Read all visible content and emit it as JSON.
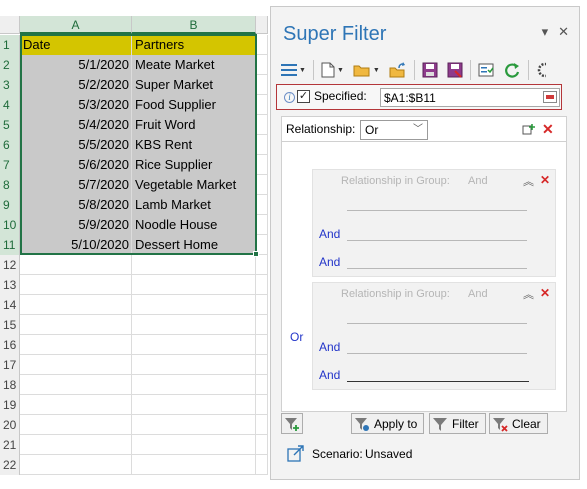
{
  "sheet": {
    "columns": [
      "A",
      "B"
    ],
    "row_numbers": [
      "1",
      "2",
      "3",
      "4",
      "5",
      "6",
      "7",
      "8",
      "9",
      "10",
      "11",
      "12",
      "13",
      "14",
      "15",
      "16",
      "17",
      "18",
      "19",
      "20",
      "21",
      "22"
    ],
    "header": [
      "Date",
      "Partners"
    ],
    "rows": [
      [
        "5/1/2020",
        "Meate Market"
      ],
      [
        "5/2/2020",
        "Super Market"
      ],
      [
        "5/3/2020",
        "Food Supplier"
      ],
      [
        "5/4/2020",
        "Fruit Word"
      ],
      [
        "5/5/2020",
        "KBS Rent"
      ],
      [
        "5/6/2020",
        "Rice Supplier"
      ],
      [
        "5/7/2020",
        "Vegetable Market"
      ],
      [
        "5/8/2020",
        "Lamb Market"
      ],
      [
        "5/9/2020",
        "Noodle House"
      ],
      [
        "5/10/2020",
        "Dessert Home"
      ]
    ],
    "header_fill": "#d4c500",
    "data_fill": "#c9c9c9",
    "selection_color": "#217346"
  },
  "pane": {
    "title": "Super Filter",
    "controls": {
      "dropdown": "▾",
      "close": "✕"
    },
    "specified": {
      "checked": true,
      "label": "Specified:",
      "range": "$A1:$B11"
    },
    "relationship": {
      "label": "Relationship:",
      "value": "Or"
    },
    "or_label": "Or",
    "groups": [
      {
        "title": "Relationship in Group:",
        "relation": "And",
        "conditions": [
          "And",
          "And"
        ]
      },
      {
        "title": "Relationship in Group:",
        "relation": "And",
        "conditions": [
          "And",
          "And"
        ]
      }
    ],
    "buttons": {
      "apply_to": "Apply to",
      "filter": "Filter",
      "clear": "Clear"
    },
    "scenario": {
      "label": "Scenario:",
      "value": "Unsaved"
    },
    "accent_color": "#2e75b6",
    "delete_color": "#d62828",
    "and_color": "#2335c9"
  }
}
